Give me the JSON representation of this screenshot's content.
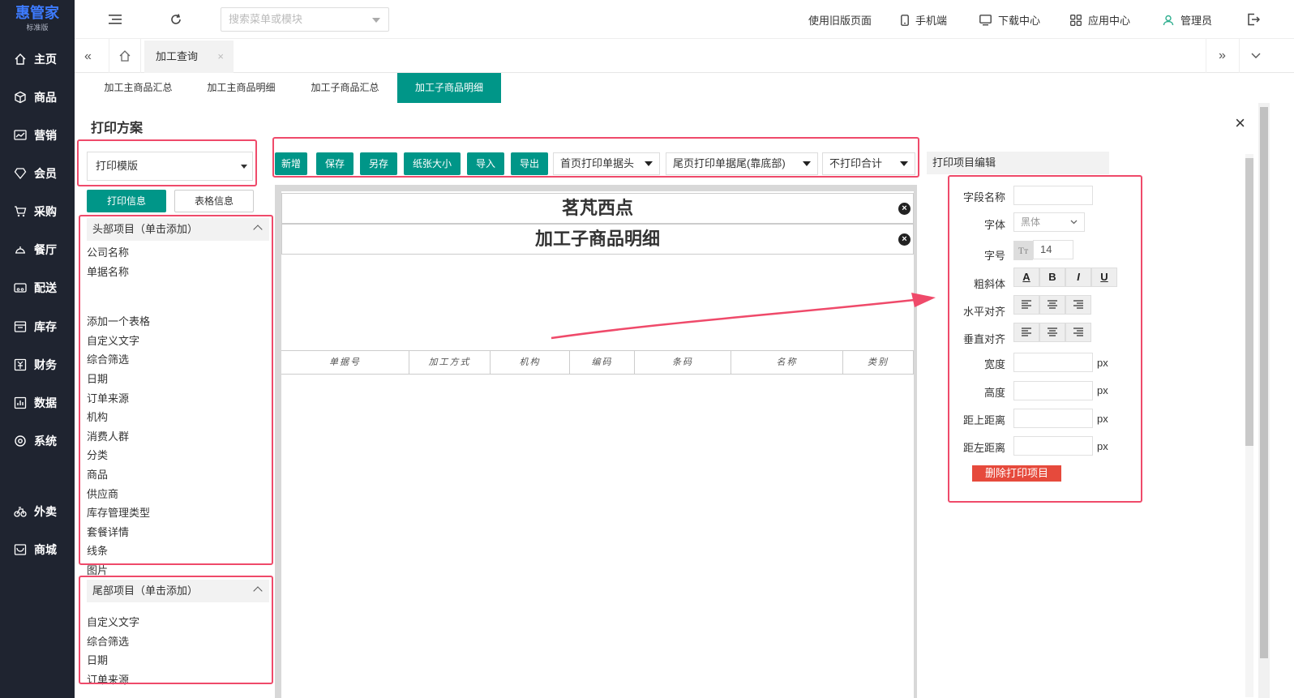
{
  "app": {
    "brand": "惠管家",
    "edition": "标准版"
  },
  "sidebar": {
    "items": [
      {
        "label": "主页",
        "icon": "home-icon"
      },
      {
        "label": "商品",
        "icon": "box-icon"
      },
      {
        "label": "营销",
        "icon": "chart-icon"
      },
      {
        "label": "会员",
        "icon": "diamond-icon"
      },
      {
        "label": "采购",
        "icon": "cart-icon"
      },
      {
        "label": "餐厅",
        "icon": "cloche-icon"
      },
      {
        "label": "配送",
        "icon": "truck-icon"
      },
      {
        "label": "库存",
        "icon": "warehouse-icon"
      },
      {
        "label": "财务",
        "icon": "money-icon"
      },
      {
        "label": "数据",
        "icon": "data-icon"
      },
      {
        "label": "系统",
        "icon": "settings-icon"
      },
      {
        "label": "外卖",
        "icon": "bike-icon"
      },
      {
        "label": "商城",
        "icon": "shop-icon"
      }
    ]
  },
  "topbar": {
    "search_placeholder": "搜索菜单或模块",
    "links": [
      "使用旧版页面",
      "手机端",
      "下载中心",
      "应用中心",
      "管理员"
    ]
  },
  "tabs": {
    "active": "加工查询",
    "close": "×"
  },
  "subtabs": [
    "加工主商品汇总",
    "加工主商品明细",
    "加工子商品汇总",
    "加工子商品明细"
  ],
  "panel": {
    "title": "打印方案",
    "template_select": "打印模版",
    "btn_print_info": "打印信息",
    "btn_table_info": "表格信息",
    "head_section_title": "头部项目（单击添加）",
    "head_items": [
      "公司名称",
      "单据名称",
      "",
      "添加一个表格",
      "自定义文字",
      "综合筛选",
      "日期",
      "订单来源",
      "机构",
      "消费人群",
      "分类",
      "商品",
      "供应商",
      "库存管理类型",
      "套餐详情",
      "线条",
      "图片"
    ],
    "tail_section_title": "尾部项目（单击添加）",
    "tail_items": [
      "自定义文字",
      "综合筛选",
      "日期",
      "订单来源"
    ]
  },
  "toolbar": {
    "buttons": [
      "新增",
      "保存",
      "另存",
      "纸张大小",
      "导入",
      "导出"
    ],
    "drop1": "首页打印单据头",
    "drop2": "尾页打印单据尾(靠底部)",
    "drop3": "不打印合计"
  },
  "canvas": {
    "title1": "茗芃西点",
    "title2": "加工子商品明细",
    "columns": [
      "单据号",
      "加工方式",
      "机构",
      "编码",
      "条码",
      "名称",
      "类别"
    ]
  },
  "editor": {
    "tab": "打印项目编辑",
    "field_name_label": "字段名称",
    "font_label": "字体",
    "font_value": "黑体",
    "size_label": "字号",
    "size_value": "14",
    "style_label": "粗斜体",
    "style_buttons": [
      "A",
      "B",
      "I",
      "U"
    ],
    "halign_label": "水平对齐",
    "valign_label": "垂直对齐",
    "width_label": "宽度",
    "height_label": "高度",
    "top_label": "距上距离",
    "left_label": "距左距离",
    "unit": "px",
    "delete_button": "删除打印项目"
  },
  "colors": {
    "accent": "#009688",
    "highlight": "#ef4a6a",
    "danger": "#e64a3c",
    "sidebar": "#1f2430"
  }
}
